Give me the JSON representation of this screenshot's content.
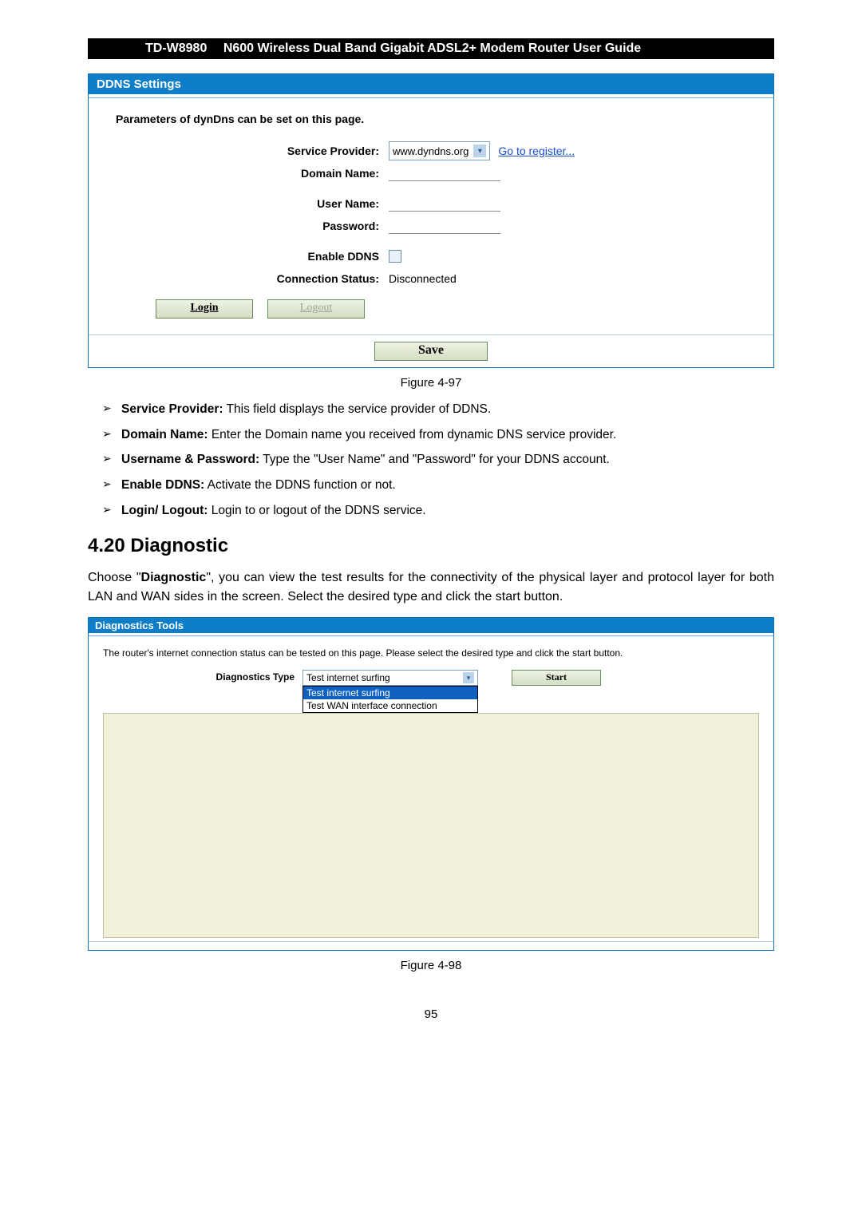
{
  "header": {
    "model": "TD-W8980",
    "title": "N600 Wireless Dual Band Gigabit ADSL2+ Modem Router User Guide"
  },
  "ddns_panel": {
    "title": "DDNS Settings",
    "intro": "Parameters of dynDns can be set on this page.",
    "labels": {
      "service_provider": "Service Provider:",
      "domain_name": "Domain Name:",
      "user_name": "User Name:",
      "password": "Password:",
      "enable_ddns": "Enable DDNS",
      "conn_status": "Connection Status:"
    },
    "service_provider_value": "www.dyndns.org",
    "register_link": "Go to register...",
    "conn_status_value": "Disconnected",
    "login_btn": "Login",
    "logout_btn": "Logout",
    "save_btn": "Save"
  },
  "fig1": "Figure 4-97",
  "bullets": {
    "b1_strong": "Service Provider:",
    "b1_rest": " This field displays the service provider of DDNS.",
    "b2_strong": "Domain Name:",
    "b2_rest": " Enter the Domain name you received from dynamic DNS service provider.",
    "b3_strong": "Username & Password:",
    "b3_rest": " Type the \"User Name\" and \"Password\" for your DDNS account.",
    "b4_strong": "Enable DDNS:",
    "b4_rest": " Activate the DDNS function or not.",
    "b5_strong": "Login/ Logout:",
    "b5_rest": " Login to or logout of the DDNS service."
  },
  "section_heading": "4.20   Diagnostic",
  "body_p1a": "Choose \"",
  "body_p1b": "Diagnostic",
  "body_p1c": "\", you can view the test results for the connectivity of the physical layer and protocol layer for both LAN and WAN sides in the screen. Select the desired type and click the start button.",
  "diag_panel": {
    "title": "Diagnostics Tools",
    "intro": "The router's internet connection status can be tested on this page. Please select the desired type and click the start button.",
    "label": "Diagnostics Type",
    "selected": "Test internet surfing",
    "opt1": "Test internet surfing",
    "opt2": "Test WAN interface connection",
    "start_btn": "Start"
  },
  "fig2": "Figure 4-98",
  "page_number": "95"
}
